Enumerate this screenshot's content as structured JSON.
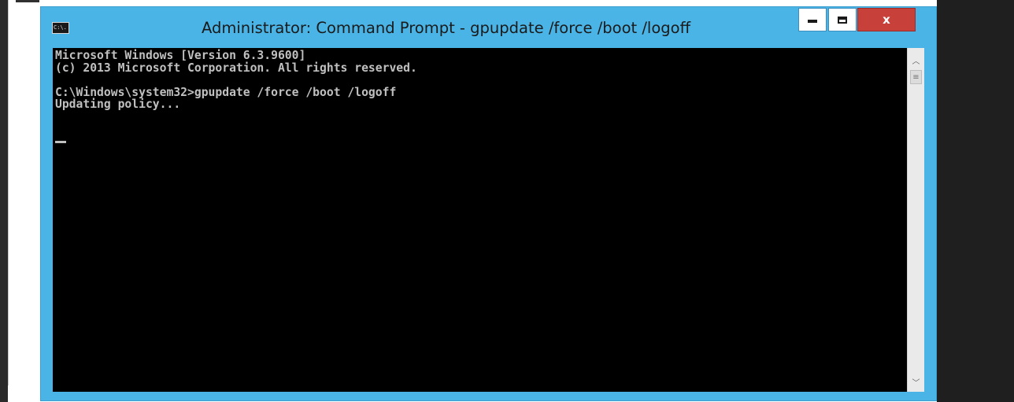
{
  "window": {
    "title": "Administrator: Command Prompt - gpupdate  /force /boot /logoff",
    "icon": "console-icon",
    "icon_text": "C:\\.",
    "accent_color": "#4ab4e6",
    "close_color": "#c7403a"
  },
  "controls": {
    "minimize_icon": "minimize-icon",
    "maximize_icon": "maximize-icon",
    "close_icon": "close-icon",
    "close_glyph": "x"
  },
  "console": {
    "lines": [
      "Microsoft Windows [Version 6.3.9600]",
      "(c) 2013 Microsoft Corporation. All rights reserved.",
      "",
      "C:\\Windows\\system32>gpupdate /force /boot /logoff",
      "Updating policy..."
    ],
    "background": "#000000",
    "text_color": "#c0c0c0"
  },
  "scrollbar": {
    "up_icon": "scroll-up-arrow-icon",
    "down_icon": "scroll-down-arrow-icon",
    "up_glyph": "︿",
    "down_glyph": "﹀",
    "thumb_glyph": "≡"
  }
}
